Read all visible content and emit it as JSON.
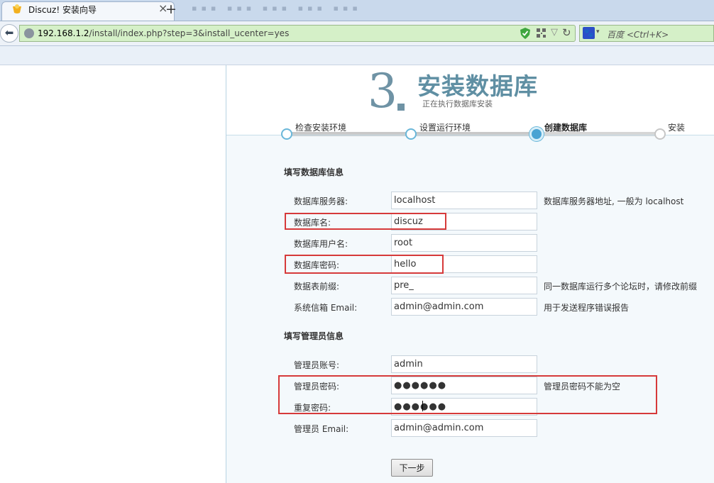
{
  "browser": {
    "tab_title": "Discuz! 安装向导",
    "tab_close": "×",
    "new_tab": "+",
    "ghost_tabs": "▪▪▪ ▪▪▪ ▪▪▪ ▪▪▪ ▪▪▪",
    "url_host": "192.168.1.2",
    "url_path": "/install/index.php?step=3&install_ucenter=yes",
    "search_placeholder": "百度 <Ctrl+K>",
    "back_glyph": "⬅",
    "star_glyph": "▽",
    "reload_glyph": "↻",
    "engine_glyph": "🐾",
    "caret_glyph": "▾"
  },
  "header": {
    "step_number": "3",
    "step_title": "安装数据库",
    "step_subtitle": "正在执行数据库安装"
  },
  "progress": {
    "steps": [
      {
        "label": "检查安装环境",
        "state": "done"
      },
      {
        "label": "设置运行环境",
        "state": "done"
      },
      {
        "label": "创建数据库",
        "state": "active"
      },
      {
        "label": "安装",
        "state": "pending"
      }
    ]
  },
  "db_section": {
    "title": "填写数据库信息",
    "fields": [
      {
        "label": "数据库服务器:",
        "value": "localhost",
        "hint": "数据库服务器地址, 一般为 localhost"
      },
      {
        "label": "数据库名:",
        "value": "discuz",
        "hint": ""
      },
      {
        "label": "数据库用户名:",
        "value": "root",
        "hint": ""
      },
      {
        "label": "数据库密码:",
        "value": "hello",
        "hint": ""
      },
      {
        "label": "数据表前缀:",
        "value": "pre_",
        "hint": "同一数据库运行多个论坛时，请修改前缀"
      },
      {
        "label": "系统信箱 Email:",
        "value": "admin@admin.com",
        "hint": "用于发送程序错误报告"
      }
    ]
  },
  "admin_section": {
    "title": "填写管理员信息",
    "fields": [
      {
        "label": "管理员账号:",
        "value": "admin",
        "hint": ""
      },
      {
        "label": "管理员密码:",
        "value": "●●●●●●",
        "hint": "管理员密码不能为空"
      },
      {
        "label": "重复密码:",
        "value": "●●●●●●",
        "hint": ""
      },
      {
        "label": "管理员 Email:",
        "value": "admin@admin.com",
        "hint": ""
      }
    ]
  },
  "next_button": "下一步",
  "colors": {
    "title": "#5f8fa3",
    "highlight": "#d63a3a",
    "progress_active": "#4aa3d3"
  }
}
